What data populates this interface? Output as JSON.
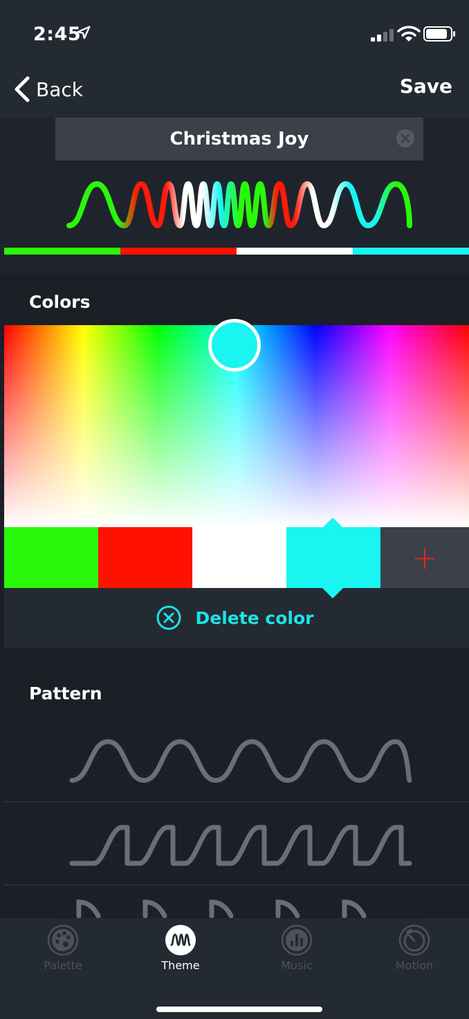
{
  "status": {
    "time": "2:45"
  },
  "nav": {
    "back_label": "Back",
    "save_label": "Save"
  },
  "theme": {
    "name": "Christmas Joy"
  },
  "colors_section": {
    "title": "Colors",
    "swatches": [
      "#2af80b",
      "#ff1100",
      "#ffffff",
      "#19f5f1"
    ],
    "selected_index": 3,
    "add_symbol": "+",
    "delete_label": "Delete color"
  },
  "pattern_section": {
    "title": "Pattern"
  },
  "tabs": [
    {
      "label": "Palette",
      "icon": "palette-icon",
      "active": false
    },
    {
      "label": "Theme",
      "icon": "wave-icon",
      "active": true
    },
    {
      "label": "Music",
      "icon": "equalizer-icon",
      "active": false
    },
    {
      "label": "Motion",
      "icon": "timer-icon",
      "active": false
    }
  ],
  "accent_color": "#1be4e6",
  "add_color": "#e8251b"
}
